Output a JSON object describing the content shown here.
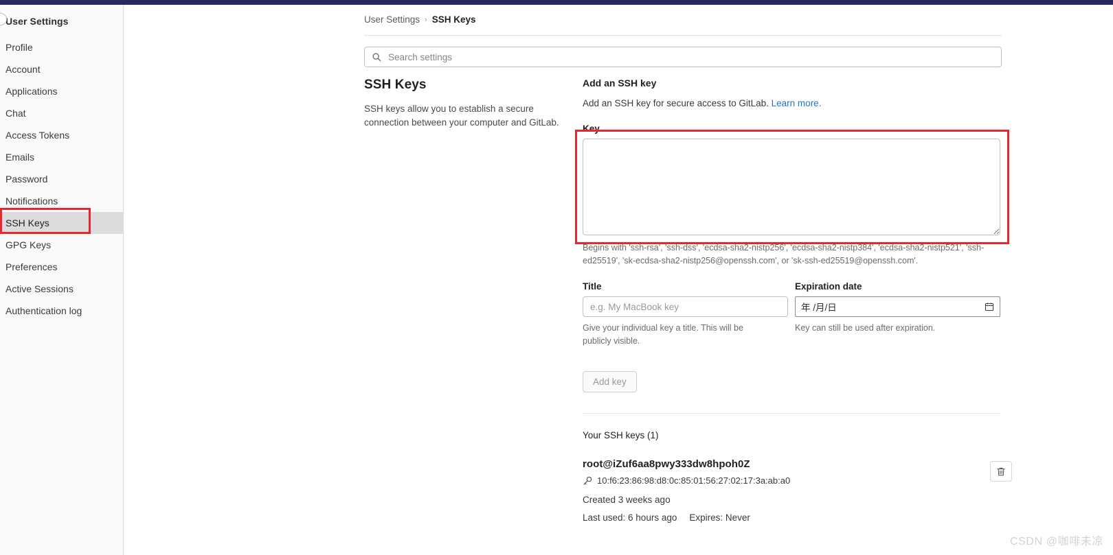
{
  "theme": {
    "navbar_color": "#292961",
    "highlight_color": "#e8262b",
    "link_color": "#1f75cb",
    "sidebar_bg": "#fafafa",
    "active_item_bg": "#dcdcde"
  },
  "sidebar": {
    "title": "User Settings",
    "items": [
      {
        "label": "Profile",
        "active": false
      },
      {
        "label": "Account",
        "active": false
      },
      {
        "label": "Applications",
        "active": false
      },
      {
        "label": "Chat",
        "active": false
      },
      {
        "label": "Access Tokens",
        "active": false
      },
      {
        "label": "Emails",
        "active": false
      },
      {
        "label": "Password",
        "active": false
      },
      {
        "label": "Notifications",
        "active": false
      },
      {
        "label": "SSH Keys",
        "active": true
      },
      {
        "label": "GPG Keys",
        "active": false
      },
      {
        "label": "Preferences",
        "active": false
      },
      {
        "label": "Active Sessions",
        "active": false
      },
      {
        "label": "Authentication log",
        "active": false
      }
    ]
  },
  "breadcrumb": {
    "parent": "User Settings",
    "separator": "›",
    "current": "SSH Keys"
  },
  "search": {
    "placeholder": "Search settings",
    "value": "",
    "icon": "search-icon"
  },
  "page": {
    "title": "SSH Keys",
    "description": "SSH keys allow you to establish a secure connection between your computer and GitLab."
  },
  "add_key_form": {
    "section_title": "Add an SSH key",
    "section_description": "Add an SSH key for secure access to GitLab.",
    "learn_more_label": "Learn more.",
    "key_label": "Key",
    "key_value": "",
    "key_helper": "Begins with 'ssh-rsa', 'ssh-dss', 'ecdsa-sha2-nistp256', 'ecdsa-sha2-nistp384', 'ecdsa-sha2-nistp521', 'ssh-ed25519', 'sk-ecdsa-sha2-nistp256@openssh.com', or 'sk-ssh-ed25519@openssh.com'.",
    "title_label": "Title",
    "title_placeholder": "e.g. My MacBook key",
    "title_value": "",
    "title_helper": "Give your individual key a title. This will be publicly visible.",
    "expiration_label": "Expiration date",
    "expiration_placeholder": "年 /月/日",
    "expiration_helper": "Key can still be used after expiration.",
    "submit_label": "Add key"
  },
  "keys_list": {
    "heading": "Your SSH keys (1)",
    "items": [
      {
        "name": "root@iZuf6aa8pwy333dw8hpoh0Z",
        "fingerprint": "10:f6:23:86:98:d8:0c:85:01:56:27:02:17:3a:ab:a0",
        "created": "Created 3 weeks ago",
        "last_used": "Last used: 6 hours ago",
        "expires": "Expires: Never",
        "delete_icon": "trash-icon"
      }
    ]
  },
  "watermark": {
    "text": "CSDN @咖啡未凉"
  }
}
